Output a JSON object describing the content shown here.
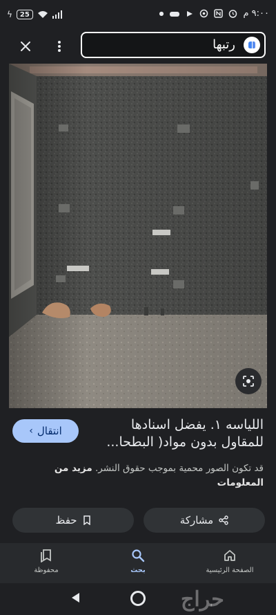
{
  "status_bar": {
    "battery": "25",
    "time": "٩:٠٠ م"
  },
  "header": {
    "search_text": "رتبها"
  },
  "result": {
    "title": "اللياسه ١. يفضل اسنادها للمقاول بدون مواد( البطحا...",
    "visit_label": "انتقال",
    "copyright_text": "قد تكون الصور محمية بموجب حقوق النشر.",
    "more_info_label": "مزيد من المعلومات"
  },
  "actions": {
    "share_label": "مشاركة",
    "save_label": "حفظ"
  },
  "bottom_nav": {
    "items": [
      {
        "label": "محفوظة",
        "icon": "bookmark-icon"
      },
      {
        "label": "بحث",
        "icon": "search-icon"
      },
      {
        "label": "الصفحة الرئيسية",
        "icon": "home-icon"
      }
    ]
  },
  "watermark": "حراج",
  "colors": {
    "background": "#1f2023",
    "accent": "#a8c7fa",
    "button": "#303336"
  }
}
